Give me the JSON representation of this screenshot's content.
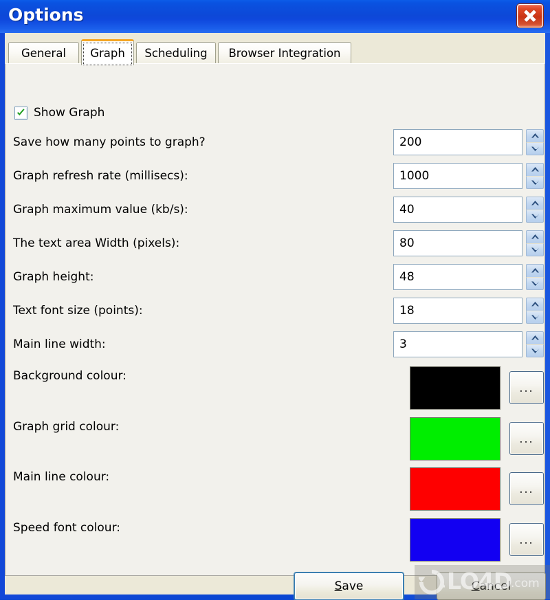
{
  "window": {
    "title": "Options",
    "close_icon": "close-icon"
  },
  "tabs": [
    {
      "label": "General",
      "selected": false
    },
    {
      "label": "Graph",
      "selected": true
    },
    {
      "label": "Scheduling",
      "selected": false
    },
    {
      "label": "Browser Integration",
      "selected": false
    }
  ],
  "checkbox": {
    "label": "Show Graph",
    "checked": true,
    "check_color": "#1f9e1f"
  },
  "number_fields": [
    {
      "label": "Save how many points to graph?",
      "value": "200"
    },
    {
      "label": "Graph refresh rate (millisecs):",
      "value": "1000"
    },
    {
      "label": "Graph maximum value (kb/s):",
      "value": "40"
    },
    {
      "label": "The text area Width (pixels):",
      "value": "80"
    },
    {
      "label": "Graph height:",
      "value": "48"
    },
    {
      "label": "Text font size (points):",
      "value": "18"
    },
    {
      "label": "Main line width:",
      "value": "3"
    }
  ],
  "colour_fields": [
    {
      "label": "Background colour:",
      "colour": "#000000",
      "browse_label": "..."
    },
    {
      "label": "Graph grid colour:",
      "colour": "#00ee00",
      "browse_label": "..."
    },
    {
      "label": "Main line colour:",
      "colour": "#fe0000",
      "browse_label": "..."
    },
    {
      "label": "Speed font colour:",
      "colour": "#1200f2",
      "browse_label": "..."
    }
  ],
  "buttons": {
    "save": {
      "label": "Save",
      "accel": "S",
      "default": true
    },
    "cancel": {
      "label": "Cancel",
      "accel": "C",
      "default": false
    }
  },
  "watermark": {
    "brand": "LO4D",
    "domain": ".com"
  }
}
